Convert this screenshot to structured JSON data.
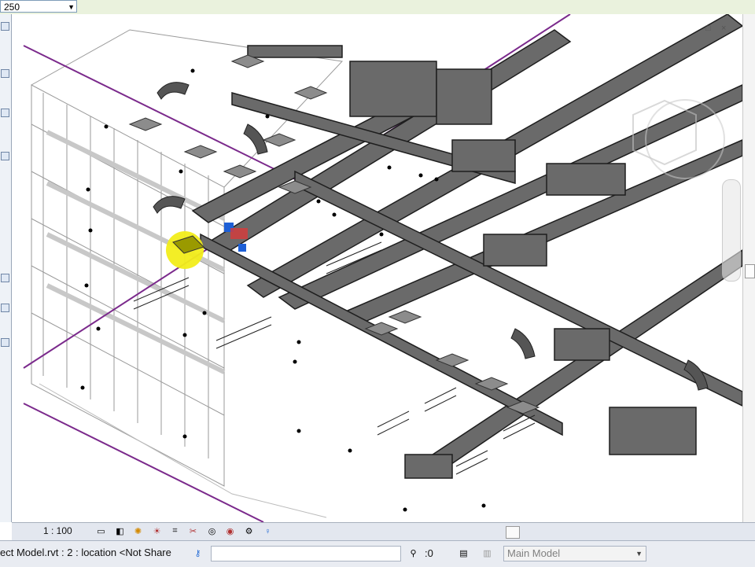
{
  "toolbar": {
    "scale_combo_value": "250"
  },
  "viewport": {
    "controls": [
      "□",
      "×"
    ],
    "highlight_color": "#f2ed1a",
    "grid_line_color": "#7b2a8c"
  },
  "view_control_bar": {
    "scale": "1 : 100",
    "icons": [
      "detail-level-icon",
      "visual-style-icon",
      "sun-path-icon",
      "shadows-icon",
      "crop-view-icon",
      "show-crop-icon",
      "temporary-hide-icon",
      "reveal-hidden-icon",
      "analysis-icon",
      "highlight-icon"
    ]
  },
  "status_bar": {
    "text": "ect Model.rvt : 2 : location <Not Share",
    "filter_count": ":0",
    "active_model": "Main Model"
  }
}
